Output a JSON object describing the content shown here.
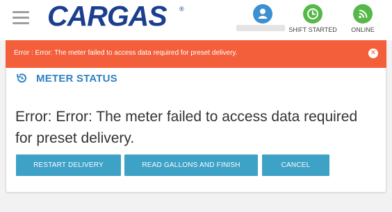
{
  "header": {
    "logo_text": "CARGAS",
    "logo_mark": "®",
    "status": [
      {
        "label": "",
        "icon": "user-icon",
        "color": "#3c8fd0"
      },
      {
        "label": "SHIFT STARTED",
        "icon": "clock-icon",
        "color": "#55b848"
      },
      {
        "label": "ONLINE",
        "icon": "wifi-icon",
        "color": "#55b848"
      }
    ]
  },
  "banner": {
    "text": "Error : Error: The meter failed to access data required for preset delivery.",
    "close_glyph": "✕",
    "color": "#f45f3b"
  },
  "section": {
    "title": "METER STATUS",
    "icon": "history-icon"
  },
  "main": {
    "message": "Error: Error: The meter failed to access data required for preset delivery."
  },
  "actions": {
    "restart": "RESTART DELIVERY",
    "read": "READ GALLONS AND FINISH",
    "cancel": "CANCEL",
    "color": "#3ea1c6"
  }
}
